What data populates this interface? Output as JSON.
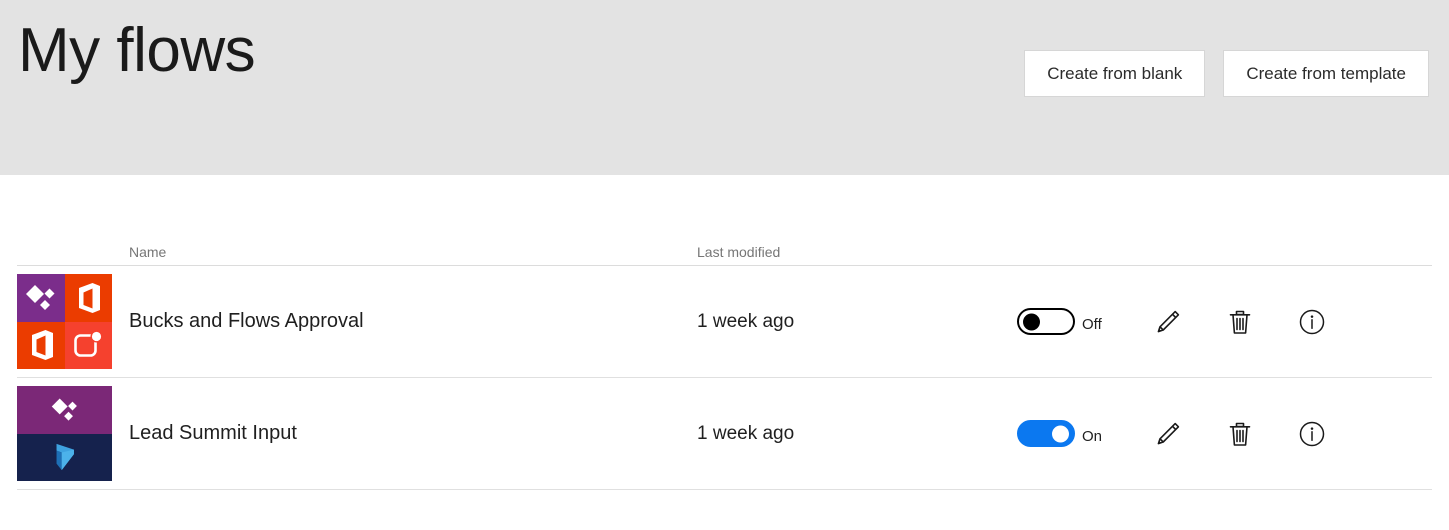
{
  "header": {
    "title": "My flows",
    "buttons": [
      {
        "label": "Create from blank",
        "name": "create-from-blank-button"
      },
      {
        "label": "Create from template",
        "name": "create-from-template-button"
      }
    ],
    "background_color": "#e3e3e3"
  },
  "table": {
    "columns": {
      "name": "Name",
      "last_modified": "Last modified"
    },
    "rows": [
      {
        "name": "Bucks and Flows Approval",
        "last_modified": "1 week ago",
        "toggle_state": "Off",
        "toggle_on": false,
        "icon_type": "quad",
        "icon_tiles": [
          {
            "color": "#7b2d8b",
            "glyph": "diamonds-icon"
          },
          {
            "color": "#eb3c00",
            "glyph": "office-icon"
          },
          {
            "color": "#eb3c00",
            "glyph": "office-icon"
          },
          {
            "color": "#f5412e",
            "glyph": "planner-icon"
          }
        ],
        "actions": [
          {
            "label": "Edit",
            "name": "edit-flow-button",
            "icon": "pencil-icon"
          },
          {
            "label": "Delete",
            "name": "delete-flow-button",
            "icon": "trash-icon"
          },
          {
            "label": "Details",
            "name": "info-flow-button",
            "icon": "info-icon"
          }
        ]
      },
      {
        "name": "Lead Summit Input",
        "last_modified": "1 week ago",
        "toggle_state": "On",
        "toggle_on": true,
        "icon_type": "halves",
        "icon_tiles": [
          {
            "color": "#7b2877",
            "glyph": "diamonds-icon"
          },
          {
            "color": "#15224d",
            "glyph": "dynamics-icon"
          }
        ],
        "actions": [
          {
            "label": "Edit",
            "name": "edit-flow-button",
            "icon": "pencil-icon"
          },
          {
            "label": "Delete",
            "name": "delete-flow-button",
            "icon": "trash-icon"
          },
          {
            "label": "Details",
            "name": "info-flow-button",
            "icon": "info-icon"
          }
        ]
      }
    ]
  },
  "colors": {
    "accent_blue": "#0b78f0",
    "header_gray": "#e3e3e3",
    "border_gray": "#e0e0e0",
    "muted_text": "#767676"
  }
}
